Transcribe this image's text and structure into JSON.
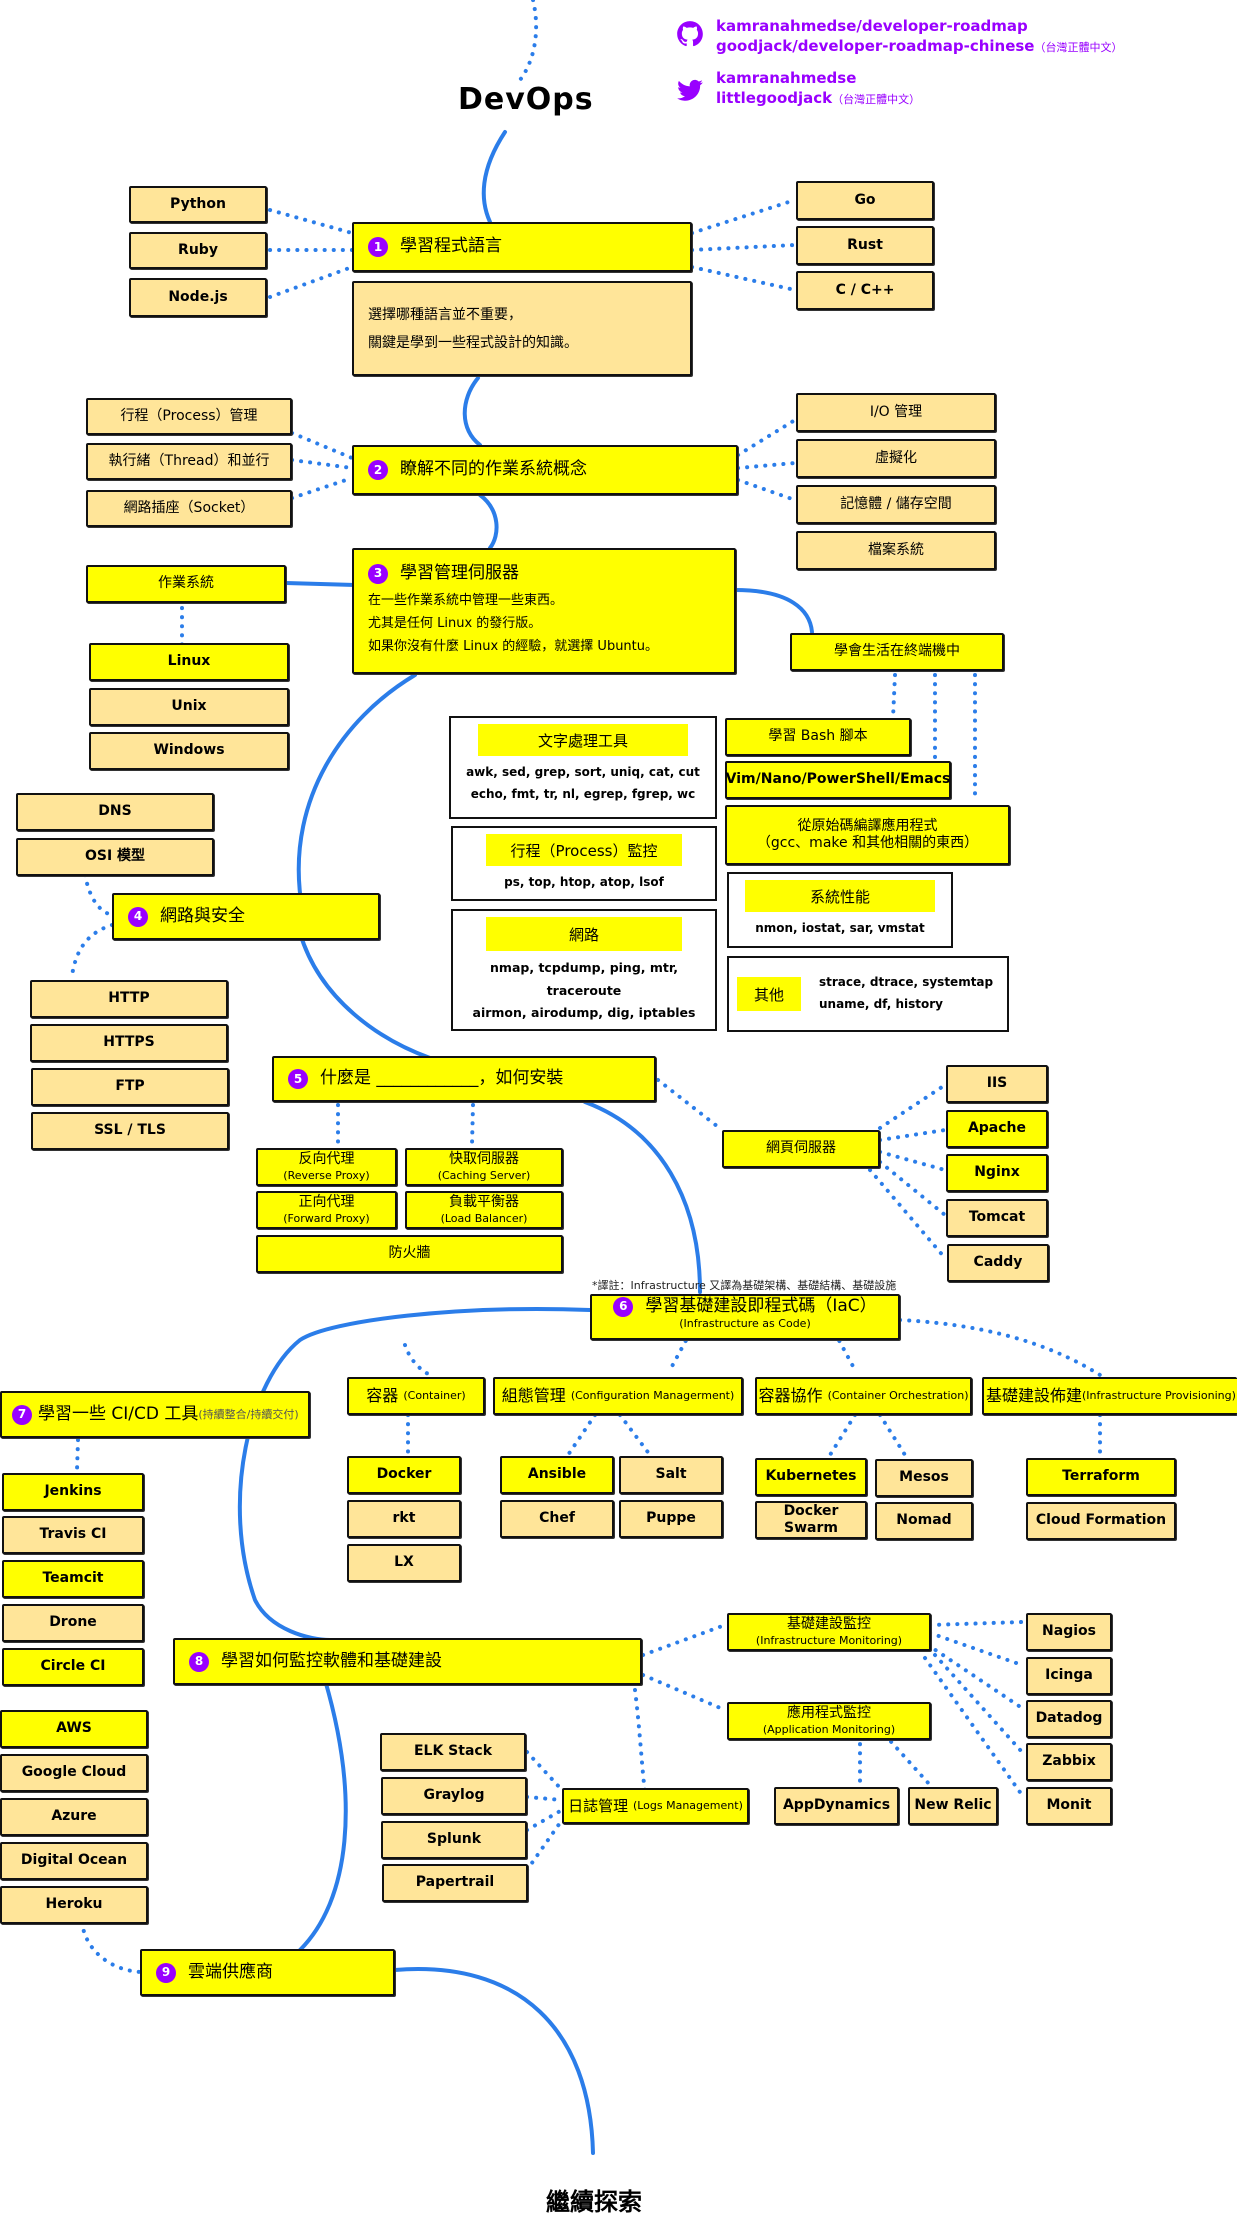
{
  "title": "DevOps",
  "footer": "繼續探索",
  "translator_note": "*譯註：Infrastructure 又譯為基礎架構、基礎結構、基礎設施",
  "colors": {
    "required": "#ffff00",
    "optional": "#ffe599",
    "accent": "#9900ff",
    "line": "#2b7de9"
  },
  "links": {
    "github": {
      "icon": "github-icon",
      "lines": [
        "kamranahmedse/developer-roadmap",
        "goodjack/developer-roadmap-chinese"
      ],
      "suffix": "（台灣正體中文）"
    },
    "twitter": {
      "icon": "twitter-icon",
      "lines": [
        "kamranahmedse",
        "littlegoodjack"
      ],
      "suffix": "（台灣正體中文）"
    }
  },
  "steps": [
    {
      "num": "1",
      "label": "學習程式語言",
      "note": [
        "選擇哪種語言並不重要，",
        "關鍵是學到一些程式設計的知識。"
      ],
      "left": [
        "Python",
        "Ruby",
        "Node.js"
      ],
      "right": [
        "Go",
        "Rust",
        "C / C++"
      ]
    },
    {
      "num": "2",
      "label": "瞭解不同的作業系統概念",
      "left": [
        "行程（Process）管理",
        "執行緒（Thread）和並行",
        "網路插座（Socket）"
      ],
      "right": [
        "I/O 管理",
        "虛擬化",
        "記憶體 / 儲存空間",
        "檔案系統"
      ]
    },
    {
      "num": "3",
      "label": "學習管理伺服器",
      "desc": [
        "在一些作業系統中管理一些東西。",
        "尤其是任何 Linux 的發行版。",
        "如果你沒有什麼 Linux 的經驗，就選擇 Ubuntu。"
      ],
      "os": {
        "label": "作業系統",
        "items": [
          "Linux",
          "Unix",
          "Windows"
        ]
      },
      "terminal": {
        "label": "學會生活在終端機中",
        "items": [
          "學習 Bash 腳本",
          "Vim/Nano/PowerShell/Emacs",
          "從原始碼編譯應用程式",
          "（gcc、make 和其他相關的東西）"
        ],
        "tools": [
          {
            "head": "文字處理工具",
            "body": [
              "awk, sed, grep, sort, uniq, cat, cut",
              "echo, fmt, tr, nl, egrep, fgrep, wc"
            ]
          },
          {
            "head": "行程（Process）監控",
            "body": [
              "ps, top, htop, atop, lsof"
            ]
          },
          {
            "head": "網路",
            "body": [
              "nmap, tcpdump, ping, mtr, traceroute",
              "airmon, airodump, dig, iptables"
            ]
          },
          {
            "head": "系統性能",
            "body": [
              "nmon, iostat, sar, vmstat"
            ]
          },
          {
            "head": "其他",
            "body": [
              "strace, dtrace, systemtap",
              "uname, df, history"
            ]
          }
        ]
      }
    },
    {
      "num": "4",
      "label": "網路與安全",
      "top": [
        "DNS",
        "OSI 模型"
      ],
      "bottom": [
        "HTTP",
        "HTTPS",
        "FTP",
        "SSL / TLS"
      ]
    },
    {
      "num": "5",
      "label": "什麼是 ____________，如何安裝",
      "items": [
        {
          "label": "反向代理",
          "sub": "(Reverse Proxy)"
        },
        {
          "label": "快取伺服器",
          "sub": "(Caching Server)"
        },
        {
          "label": "正向代理",
          "sub": "(Forward Proxy)"
        },
        {
          "label": "負載平衡器",
          "sub": "(Load Balancer)"
        },
        {
          "label": "防火牆",
          "sub": ""
        }
      ],
      "webserver": {
        "label": "網頁伺服器",
        "items": [
          "IIS",
          "Apache",
          "Nginx",
          "Tomcat",
          "Caddy"
        ]
      }
    },
    {
      "num": "6",
      "label": "學習基礎建設即程式碼（IaC）",
      "sub": "(Infrastructure as Code)",
      "groups": [
        {
          "label": "容器",
          "sub": "(Container)",
          "items": [
            "Docker",
            "rkt",
            "LX"
          ]
        },
        {
          "label": "組態管理",
          "sub": "(Configuration Managerment)",
          "items": [
            "Ansible",
            "Salt",
            "Chef",
            "Puppe"
          ]
        },
        {
          "label": "容器協作",
          "sub": "(Container Orchestration)",
          "items": [
            "Kubernetes",
            "Mesos",
            "Docker Swarm",
            "Nomad"
          ]
        },
        {
          "label": "基礎建設佈建",
          "sub": "(Infrastructure Provisioning)",
          "items": [
            "Terraform",
            "Cloud Formation"
          ]
        }
      ]
    },
    {
      "num": "7",
      "label": "學習一些 CI/CD 工具",
      "sub": "(持續整合/持續交付)",
      "items": [
        "Jenkins",
        "Travis CI",
        "Teamcit",
        "Drone",
        "Circle CI"
      ]
    },
    {
      "num": "8",
      "label": "學習如何監控軟體和基礎建設",
      "infra": {
        "label": "基礎建設監控",
        "sub": "(Infrastructure Monitoring)",
        "items": [
          "Nagios",
          "Icinga",
          "Datadog",
          "Zabbix",
          "Monit"
        ]
      },
      "app": {
        "label": "應用程式監控",
        "sub": "(Application Monitoring)",
        "items": [
          "AppDynamics",
          "New Relic"
        ]
      },
      "logs": {
        "label": "日誌管理",
        "sub": "(Logs Management)",
        "items": [
          "ELK Stack",
          "Graylog",
          "Splunk",
          "Papertrail"
        ]
      }
    },
    {
      "num": "9",
      "label": "雲端供應商",
      "items": [
        "AWS",
        "Google Cloud",
        "Azure",
        "Digital Ocean",
        "Heroku"
      ]
    }
  ]
}
